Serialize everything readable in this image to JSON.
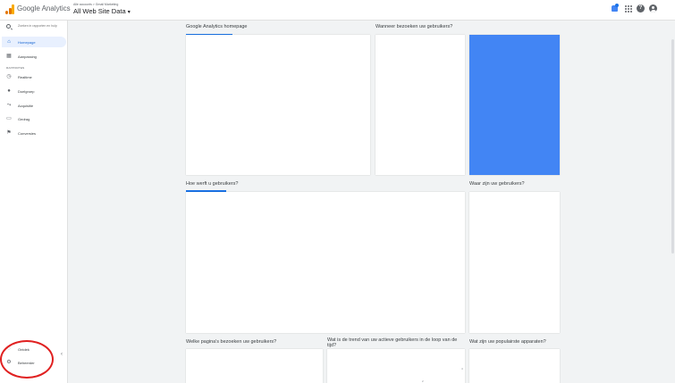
{
  "header": {
    "brand": "Google Analytics",
    "breadcrumb": "Alle accounts > Gmail Marketing",
    "property": "All Web Site Data",
    "property_caret": "▾",
    "help_glyph": "?"
  },
  "sidebar": {
    "search_placeholder": "Zoeken in rapporten en hulp",
    "items": [
      {
        "label": "Homepage",
        "icon": "home-icon",
        "glyph": "⌂"
      },
      {
        "label": "Aanpassing",
        "icon": "customization-icon",
        "glyph": "▦"
      }
    ],
    "section_label": "RAPPORTEN",
    "report_items": [
      {
        "label": "Realtime",
        "icon": "clock-icon",
        "glyph": "◷"
      },
      {
        "label": "Doelgroep",
        "icon": "person-icon",
        "glyph": "●"
      },
      {
        "label": "Acquisitie",
        "icon": "acquisition-icon",
        "glyph": "⤳"
      },
      {
        "label": "Gedrag",
        "icon": "behavior-icon",
        "glyph": "▭"
      },
      {
        "label": "Conversies",
        "icon": "flag-icon",
        "glyph": "⚑"
      }
    ],
    "bottom_items": [
      {
        "label": "Ontdek",
        "icon": "lightbulb-icon",
        "glyph": "◌"
      },
      {
        "label": "Beheerder",
        "icon": "gear-icon",
        "glyph": "⚙"
      }
    ],
    "collapse_glyph": "‹"
  },
  "main": {
    "cards": [
      {
        "title": "Google Analytics homepage"
      },
      {
        "title": "Wanneer bezoeken uw gebruikers?"
      },
      {
        "title": "Hoe werft u gebruikers?"
      },
      {
        "title": "Waar zijn uw gebruikers?"
      },
      {
        "title": "Welke pagina's bezoeken uw gebruikers?"
      },
      {
        "title": "Wat is de trend van uw actieve gebruikers in de loop van de tijd?"
      },
      {
        "title": "Wat zijn uw populairste apparaten?"
      }
    ],
    "trend_ticks": [
      "4",
      "2"
    ]
  },
  "colors": {
    "accent": "#1a73e8",
    "heatmap_blue": "#4285f4",
    "annotation_red": "#e02020"
  }
}
